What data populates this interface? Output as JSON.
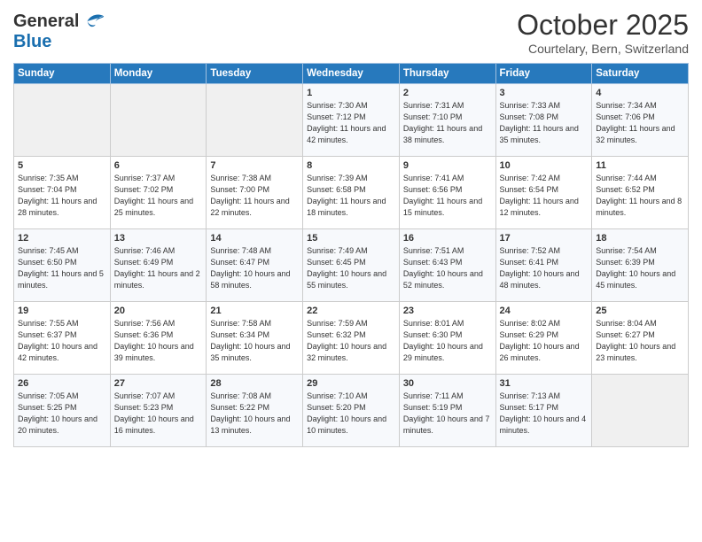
{
  "logo": {
    "general": "General",
    "blue": "Blue"
  },
  "header": {
    "month": "October 2025",
    "location": "Courtelary, Bern, Switzerland"
  },
  "days_of_week": [
    "Sunday",
    "Monday",
    "Tuesday",
    "Wednesday",
    "Thursday",
    "Friday",
    "Saturday"
  ],
  "weeks": [
    [
      {
        "day": "",
        "sunrise": "",
        "sunset": "",
        "daylight": "",
        "empty": true
      },
      {
        "day": "",
        "sunrise": "",
        "sunset": "",
        "daylight": "",
        "empty": true
      },
      {
        "day": "",
        "sunrise": "",
        "sunset": "",
        "daylight": "",
        "empty": true
      },
      {
        "day": "1",
        "sunrise": "Sunrise: 7:30 AM",
        "sunset": "Sunset: 7:12 PM",
        "daylight": "Daylight: 11 hours and 42 minutes."
      },
      {
        "day": "2",
        "sunrise": "Sunrise: 7:31 AM",
        "sunset": "Sunset: 7:10 PM",
        "daylight": "Daylight: 11 hours and 38 minutes."
      },
      {
        "day": "3",
        "sunrise": "Sunrise: 7:33 AM",
        "sunset": "Sunset: 7:08 PM",
        "daylight": "Daylight: 11 hours and 35 minutes."
      },
      {
        "day": "4",
        "sunrise": "Sunrise: 7:34 AM",
        "sunset": "Sunset: 7:06 PM",
        "daylight": "Daylight: 11 hours and 32 minutes."
      }
    ],
    [
      {
        "day": "5",
        "sunrise": "Sunrise: 7:35 AM",
        "sunset": "Sunset: 7:04 PM",
        "daylight": "Daylight: 11 hours and 28 minutes."
      },
      {
        "day": "6",
        "sunrise": "Sunrise: 7:37 AM",
        "sunset": "Sunset: 7:02 PM",
        "daylight": "Daylight: 11 hours and 25 minutes."
      },
      {
        "day": "7",
        "sunrise": "Sunrise: 7:38 AM",
        "sunset": "Sunset: 7:00 PM",
        "daylight": "Daylight: 11 hours and 22 minutes."
      },
      {
        "day": "8",
        "sunrise": "Sunrise: 7:39 AM",
        "sunset": "Sunset: 6:58 PM",
        "daylight": "Daylight: 11 hours and 18 minutes."
      },
      {
        "day": "9",
        "sunrise": "Sunrise: 7:41 AM",
        "sunset": "Sunset: 6:56 PM",
        "daylight": "Daylight: 11 hours and 15 minutes."
      },
      {
        "day": "10",
        "sunrise": "Sunrise: 7:42 AM",
        "sunset": "Sunset: 6:54 PM",
        "daylight": "Daylight: 11 hours and 12 minutes."
      },
      {
        "day": "11",
        "sunrise": "Sunrise: 7:44 AM",
        "sunset": "Sunset: 6:52 PM",
        "daylight": "Daylight: 11 hours and 8 minutes."
      }
    ],
    [
      {
        "day": "12",
        "sunrise": "Sunrise: 7:45 AM",
        "sunset": "Sunset: 6:50 PM",
        "daylight": "Daylight: 11 hours and 5 minutes."
      },
      {
        "day": "13",
        "sunrise": "Sunrise: 7:46 AM",
        "sunset": "Sunset: 6:49 PM",
        "daylight": "Daylight: 11 hours and 2 minutes."
      },
      {
        "day": "14",
        "sunrise": "Sunrise: 7:48 AM",
        "sunset": "Sunset: 6:47 PM",
        "daylight": "Daylight: 10 hours and 58 minutes."
      },
      {
        "day": "15",
        "sunrise": "Sunrise: 7:49 AM",
        "sunset": "Sunset: 6:45 PM",
        "daylight": "Daylight: 10 hours and 55 minutes."
      },
      {
        "day": "16",
        "sunrise": "Sunrise: 7:51 AM",
        "sunset": "Sunset: 6:43 PM",
        "daylight": "Daylight: 10 hours and 52 minutes."
      },
      {
        "day": "17",
        "sunrise": "Sunrise: 7:52 AM",
        "sunset": "Sunset: 6:41 PM",
        "daylight": "Daylight: 10 hours and 48 minutes."
      },
      {
        "day": "18",
        "sunrise": "Sunrise: 7:54 AM",
        "sunset": "Sunset: 6:39 PM",
        "daylight": "Daylight: 10 hours and 45 minutes."
      }
    ],
    [
      {
        "day": "19",
        "sunrise": "Sunrise: 7:55 AM",
        "sunset": "Sunset: 6:37 PM",
        "daylight": "Daylight: 10 hours and 42 minutes."
      },
      {
        "day": "20",
        "sunrise": "Sunrise: 7:56 AM",
        "sunset": "Sunset: 6:36 PM",
        "daylight": "Daylight: 10 hours and 39 minutes."
      },
      {
        "day": "21",
        "sunrise": "Sunrise: 7:58 AM",
        "sunset": "Sunset: 6:34 PM",
        "daylight": "Daylight: 10 hours and 35 minutes."
      },
      {
        "day": "22",
        "sunrise": "Sunrise: 7:59 AM",
        "sunset": "Sunset: 6:32 PM",
        "daylight": "Daylight: 10 hours and 32 minutes."
      },
      {
        "day": "23",
        "sunrise": "Sunrise: 8:01 AM",
        "sunset": "Sunset: 6:30 PM",
        "daylight": "Daylight: 10 hours and 29 minutes."
      },
      {
        "day": "24",
        "sunrise": "Sunrise: 8:02 AM",
        "sunset": "Sunset: 6:29 PM",
        "daylight": "Daylight: 10 hours and 26 minutes."
      },
      {
        "day": "25",
        "sunrise": "Sunrise: 8:04 AM",
        "sunset": "Sunset: 6:27 PM",
        "daylight": "Daylight: 10 hours and 23 minutes."
      }
    ],
    [
      {
        "day": "26",
        "sunrise": "Sunrise: 7:05 AM",
        "sunset": "Sunset: 5:25 PM",
        "daylight": "Daylight: 10 hours and 20 minutes."
      },
      {
        "day": "27",
        "sunrise": "Sunrise: 7:07 AM",
        "sunset": "Sunset: 5:23 PM",
        "daylight": "Daylight: 10 hours and 16 minutes."
      },
      {
        "day": "28",
        "sunrise": "Sunrise: 7:08 AM",
        "sunset": "Sunset: 5:22 PM",
        "daylight": "Daylight: 10 hours and 13 minutes."
      },
      {
        "day": "29",
        "sunrise": "Sunrise: 7:10 AM",
        "sunset": "Sunset: 5:20 PM",
        "daylight": "Daylight: 10 hours and 10 minutes."
      },
      {
        "day": "30",
        "sunrise": "Sunrise: 7:11 AM",
        "sunset": "Sunset: 5:19 PM",
        "daylight": "Daylight: 10 hours and 7 minutes."
      },
      {
        "day": "31",
        "sunrise": "Sunrise: 7:13 AM",
        "sunset": "Sunset: 5:17 PM",
        "daylight": "Daylight: 10 hours and 4 minutes."
      },
      {
        "day": "",
        "sunrise": "",
        "sunset": "",
        "daylight": "",
        "empty": true
      }
    ]
  ]
}
